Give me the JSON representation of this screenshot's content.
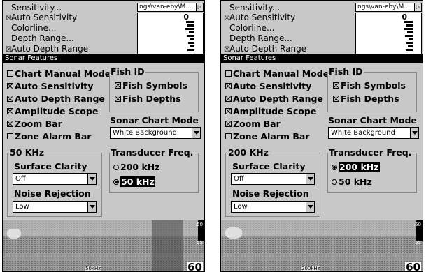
{
  "panels": [
    {
      "menu": {
        "items": [
          {
            "label": "Sensitivity...",
            "checked": false
          },
          {
            "label": "Auto Sensitivity",
            "checked": true
          },
          {
            "label": "Colorline...",
            "checked": false
          },
          {
            "label": "Depth Range...",
            "checked": false
          },
          {
            "label": "Auto Depth Range",
            "checked": true
          }
        ],
        "tab_text": "ngs\\van-eby\\M...",
        "mini_depth": "0"
      },
      "dialog_title": "Sonar Features",
      "options": {
        "chart_manual_mode": {
          "label": "Chart Manual Mode",
          "checked": false
        },
        "auto_sensitivity": {
          "label": "Auto Sensitivity",
          "checked": true
        },
        "auto_depth_range": {
          "label": "Auto Depth Range",
          "checked": true
        },
        "amplitude_scope": {
          "label": "Amplitude Scope",
          "checked": true
        },
        "zoom_bar": {
          "label": "Zoom Bar",
          "checked": true
        },
        "zone_alarm_bar": {
          "label": "Zone Alarm Bar",
          "checked": false
        }
      },
      "fish_id": {
        "label": "Fish ID",
        "fish_symbols": {
          "label": "Fish Symbols",
          "checked": true
        },
        "fish_depths": {
          "label": "Fish Depths",
          "checked": true
        }
      },
      "sonar_chart_mode": {
        "label": "Sonar Chart Mode",
        "value": "White Background"
      },
      "freq_group": {
        "label": "50 KHz",
        "surface_clarity": {
          "label": "Surface Clarity",
          "value": "Off"
        },
        "noise_rejection": {
          "label": "Noise Rejection",
          "value": "Low"
        }
      },
      "transducer": {
        "label": "Transducer Freq.",
        "options": [
          {
            "label": "200 kHz",
            "selected": false
          },
          {
            "label": "50 kHz",
            "selected": true
          }
        ]
      },
      "sonar": {
        "freq_tag": "50kHz",
        "depth_bottom": "60",
        "scale_marks": [
          "50",
          "55"
        ]
      }
    },
    {
      "menu": {
        "items": [
          {
            "label": "Sensitivity...",
            "checked": false
          },
          {
            "label": "Auto Sensitivity",
            "checked": true
          },
          {
            "label": "Colorline...",
            "checked": false
          },
          {
            "label": "Depth Range...",
            "checked": false
          },
          {
            "label": "Auto Depth Range",
            "checked": true
          }
        ],
        "tab_text": "ngs\\van-eby\\M...",
        "mini_depth": "0"
      },
      "dialog_title": "Sonar Features",
      "options": {
        "chart_manual_mode": {
          "label": "Chart Manual Mode",
          "checked": false
        },
        "auto_sensitivity": {
          "label": "Auto Sensitivity",
          "checked": true
        },
        "auto_depth_range": {
          "label": "Auto Depth Range",
          "checked": true
        },
        "amplitude_scope": {
          "label": "Amplitude Scope",
          "checked": true
        },
        "zoom_bar": {
          "label": "Zoom Bar",
          "checked": true
        },
        "zone_alarm_bar": {
          "label": "Zone Alarm Bar",
          "checked": false
        }
      },
      "fish_id": {
        "label": "Fish ID",
        "fish_symbols": {
          "label": "Fish Symbols",
          "checked": true
        },
        "fish_depths": {
          "label": "Fish Depths",
          "checked": true
        }
      },
      "sonar_chart_mode": {
        "label": "Sonar Chart Mode",
        "value": "White Background"
      },
      "freq_group": {
        "label": "200 KHz",
        "surface_clarity": {
          "label": "Surface Clarity",
          "value": "Off"
        },
        "noise_rejection": {
          "label": "Noise Rejection",
          "value": "Low"
        }
      },
      "transducer": {
        "label": "Transducer Freq.",
        "options": [
          {
            "label": "200 kHz",
            "selected": true
          },
          {
            "label": "50 kHz",
            "selected": false
          }
        ]
      },
      "sonar": {
        "freq_tag": "200kHz",
        "depth_bottom": "60",
        "scale_marks": [
          "50",
          "55"
        ]
      }
    }
  ]
}
